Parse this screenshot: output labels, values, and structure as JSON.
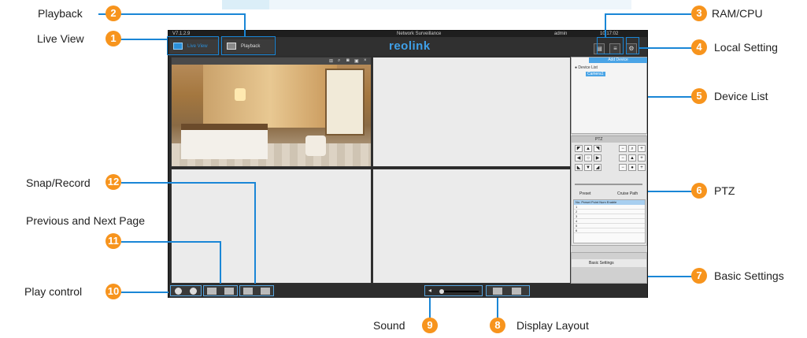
{
  "window": {
    "version": "V7.1.2.9",
    "title": "Network Surveillance",
    "user": "admin",
    "clock": "10:17:02"
  },
  "toolbar": {
    "live_view": "Live View",
    "playback": "Playback",
    "logo": "reolink"
  },
  "device_list": {
    "add_device": "Add Device",
    "root": "Device List",
    "camera": "Camera1"
  },
  "ptz": {
    "title": "PTZ",
    "tab_preset": "Preset",
    "tab_cruise": "Cruise Path",
    "table_header": "No.   Preset Point Num Enable",
    "rows": [
      "1",
      "2",
      "3",
      "4",
      "5",
      "6"
    ]
  },
  "basic_settings": {
    "title": "Basic Settings"
  },
  "callouts": {
    "c1": {
      "num": "1",
      "label": "Live View"
    },
    "c2": {
      "num": "2",
      "label": "Playback"
    },
    "c3": {
      "num": "3",
      "label": "RAM/CPU"
    },
    "c4": {
      "num": "4",
      "label": "Local Setting"
    },
    "c5": {
      "num": "5",
      "label": "Device List"
    },
    "c6": {
      "num": "6",
      "label": "PTZ"
    },
    "c7": {
      "num": "7",
      "label": "Basic Settings"
    },
    "c8": {
      "num": "8",
      "label": "Display Layout"
    },
    "c9": {
      "num": "9",
      "label": "Sound"
    },
    "c10": {
      "num": "10",
      "label": "Play control"
    },
    "c11": {
      "num": "11",
      "label": "Previous and Next Page"
    },
    "c12": {
      "num": "12",
      "label": "Snap/Record"
    }
  },
  "colors": {
    "callout_line": "#1a86d6",
    "badge": "#f7941d",
    "accent": "#4aa4e6"
  }
}
